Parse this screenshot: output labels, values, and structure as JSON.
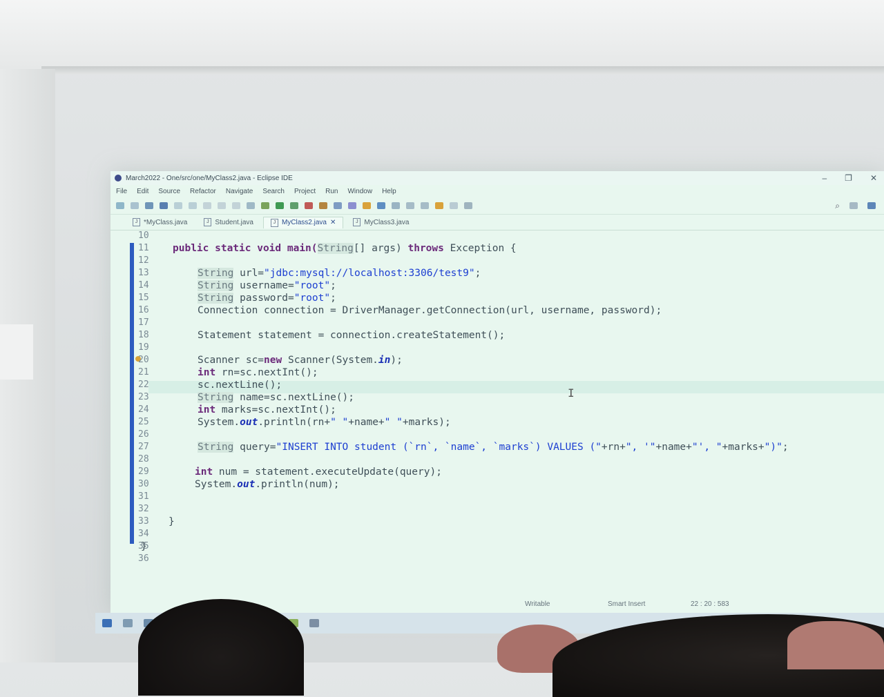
{
  "window": {
    "title": "March2022 - One/src/one/MyClass2.java - Eclipse IDE",
    "controls": [
      "–",
      "❐",
      "✕"
    ]
  },
  "menu": [
    "File",
    "Edit",
    "Source",
    "Refactor",
    "Navigate",
    "Search",
    "Project",
    "Run",
    "Window",
    "Help"
  ],
  "tabs": [
    {
      "label": "*MyClass.java",
      "active": false
    },
    {
      "label": "Student.java",
      "active": false
    },
    {
      "label": "MyClass2.java",
      "active": true,
      "close": "✕"
    },
    {
      "label": "MyClass3.java",
      "active": false
    }
  ],
  "line_numbers": [
    "10",
    "11",
    "12",
    "13",
    "14",
    "15",
    "16",
    "17",
    "18",
    "19",
    "20",
    "21",
    "22",
    "23",
    "24",
    "25",
    "26",
    "27",
    "28",
    "29",
    "30",
    "31",
    "32",
    "33",
    "34",
    "35",
    "36"
  ],
  "code": {
    "l11": [
      "public static void main(",
      "String",
      "[] args) ",
      "throws",
      " Exception {"
    ],
    "l13": [
      "String",
      " url=",
      "\"jdbc:mysql://localhost:3306/test9\"",
      ";"
    ],
    "l14": [
      "String",
      " username=",
      "\"root\"",
      ";"
    ],
    "l15": [
      "String",
      " password=",
      "\"root\"",
      ";"
    ],
    "l16": "Connection connection = DriverManager.getConnection(url, username, password);",
    "l18": "Statement statement = connection.createStatement();",
    "l20": [
      "Scanner sc=",
      "new",
      " Scanner(System.",
      "in",
      ");"
    ],
    "l21": [
      "int",
      " rn=sc.nextInt();"
    ],
    "l22": "sc.nextLine();",
    "l23": [
      "String",
      " name=sc.nextLine();"
    ],
    "l24": [
      "int",
      " marks=sc.nextInt();"
    ],
    "l25": [
      "System.",
      "out",
      ".println(rn+",
      "\" \"",
      "+name+",
      "\" \"",
      "+marks);"
    ],
    "l27": [
      "String",
      " query=",
      "\"INSERT INTO student (`rn`, `name`, `marks`) VALUES (\"",
      "+rn+",
      "\", '\"",
      "+name+",
      "\"', \"",
      "+marks+",
      "\")\"",
      ";"
    ],
    "l29": [
      "int",
      " num = statement.executeUpdate(query);"
    ],
    "l30": [
      "System.",
      "out",
      ".println(num);"
    ],
    "l33": "}",
    "l35": "}"
  },
  "status": {
    "writable": "Writable",
    "insert_mode": "Smart Insert",
    "position": "22 : 20 : 583"
  }
}
